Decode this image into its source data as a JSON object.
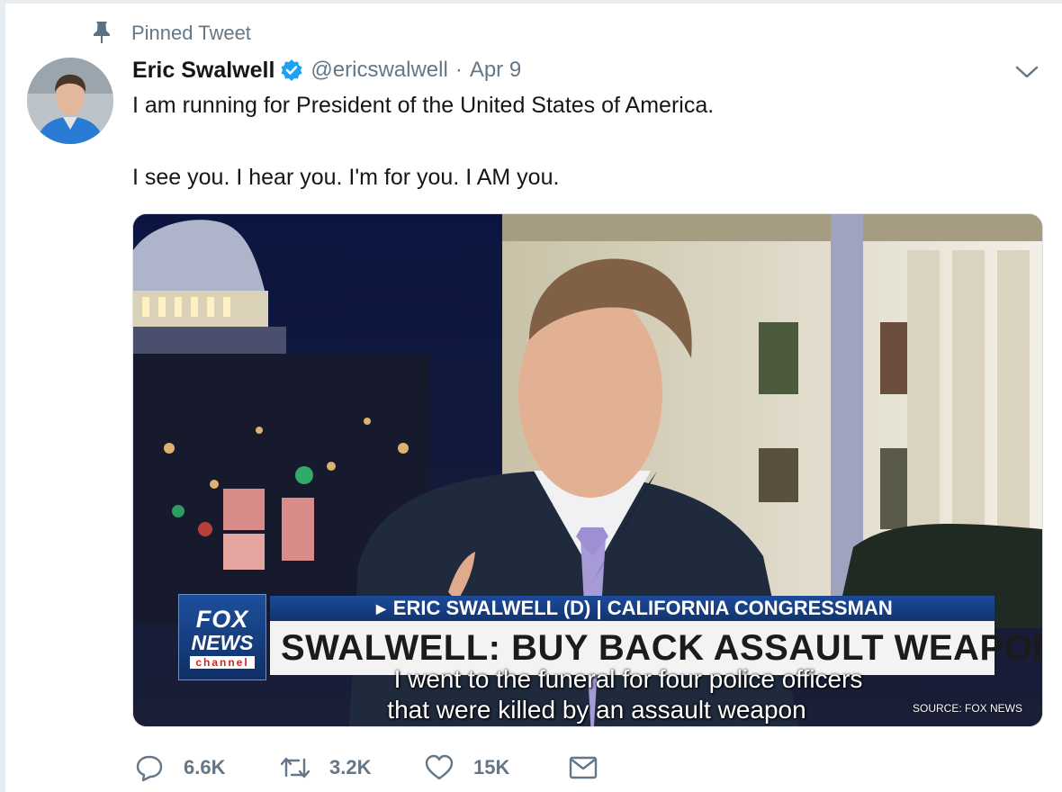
{
  "pinned_label": "Pinned Tweet",
  "tweet": {
    "display_name": "Eric Swalwell",
    "handle": "@ericswalwell",
    "separator": "·",
    "date": "Apr 9",
    "text_line1": "I am running for President of the United States of America.",
    "text_line2": "I see you. I hear you. I'm for you. I AM you."
  },
  "media": {
    "network_fox": "FOX",
    "network_news": "NEWS",
    "network_channel": "channel",
    "chyron_name": "ERIC SWALWELL (D) | CALIFORNIA CONGRESSMAN",
    "chyron_headline": "SWALWELL: BUY BACK ASSAULT WEAPONS",
    "subtitle_line1": "I went to the funeral for four police officers",
    "subtitle_line2": "that were killed by an assault weapon",
    "source": "SOURCE: FOX NEWS"
  },
  "actions": {
    "replies": "6.6K",
    "retweets": "3.2K",
    "likes": "15K"
  },
  "icons": {
    "pin": "pin-icon",
    "verified": "verified-badge-icon",
    "caret": "chevron-down-icon",
    "reply": "reply-icon",
    "retweet": "retweet-icon",
    "like": "heart-icon",
    "dm": "envelope-icon"
  },
  "colors": {
    "accent": "#1da1f2",
    "muted": "#657786",
    "text": "#14171a",
    "fox_blue": "#1c4a9a"
  }
}
